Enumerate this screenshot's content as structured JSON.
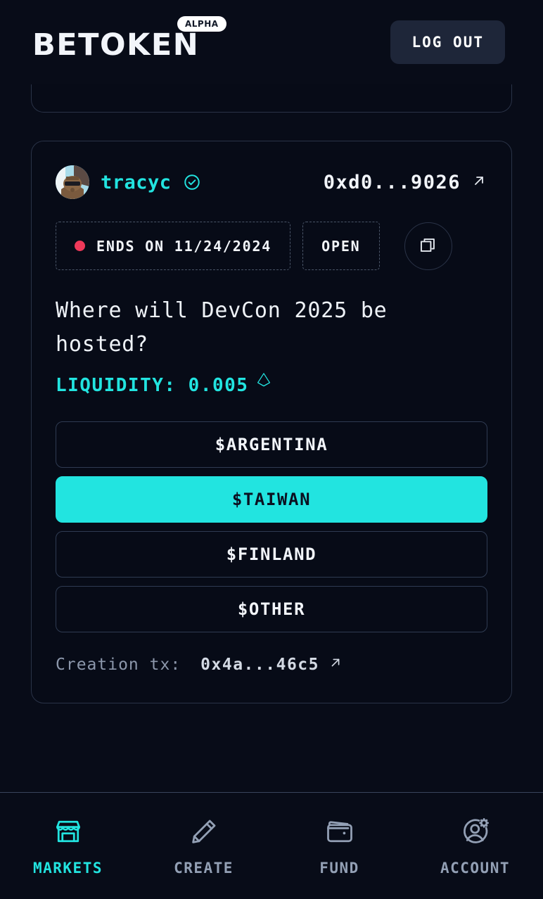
{
  "header": {
    "brand": "BETOKEN",
    "alpha_badge": "ALPHA",
    "logout_label": "LOG OUT"
  },
  "market_card": {
    "user": {
      "username": "tracyc",
      "verified_icon": "check-circle-icon",
      "avatar_icon": "avatar-image"
    },
    "address": {
      "value": "0xd0...9026",
      "link_icon": "external-link-arrow-icon"
    },
    "badges": {
      "ends_on": "ENDS ON 11/24/2024",
      "status": "OPEN",
      "status_dot_color": "#f0395a",
      "copy_icon": "copy-icon"
    },
    "question": "Where will DevCon 2025 be hosted?",
    "liquidity": {
      "label": "LIQUIDITY: 0.005",
      "currency_icon": "ethereum-icon"
    },
    "options": [
      {
        "label": "$ARGENTINA",
        "selected": false
      },
      {
        "label": "$TAIWAN",
        "selected": true
      },
      {
        "label": "$FINLAND",
        "selected": false
      },
      {
        "label": "$OTHER",
        "selected": false
      }
    ],
    "creation": {
      "label": "Creation tx:",
      "value": "0x4a...46c5",
      "link_icon": "external-link-arrow-icon"
    }
  },
  "bottom_nav": [
    {
      "label": "MARKETS",
      "icon": "storefront-icon",
      "active": true
    },
    {
      "label": "CREATE",
      "icon": "pencil-icon",
      "active": false
    },
    {
      "label": "FUND",
      "icon": "wallet-icon",
      "active": false
    },
    {
      "label": "ACCOUNT",
      "icon": "user-gear-icon",
      "active": false
    }
  ],
  "colors": {
    "background": "#080c18",
    "accent": "#22e4e0",
    "card_border": "#2a3347",
    "danger": "#f0395a",
    "muted_text": "#93a0b5"
  }
}
